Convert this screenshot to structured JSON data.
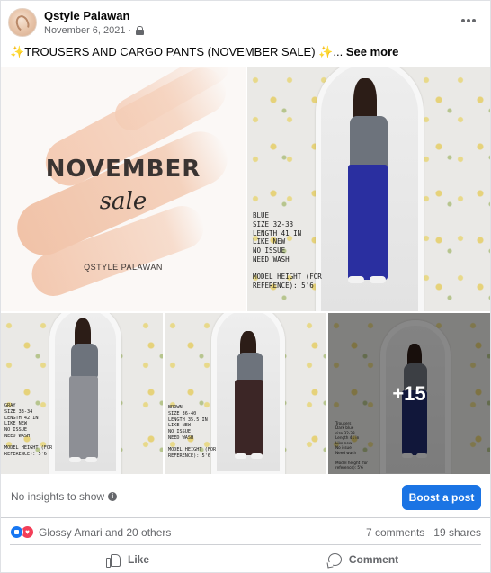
{
  "post": {
    "page_name": "Qstyle Palawan",
    "date": "November 6, 2021",
    "separator": "·",
    "privacy_icon": "lock-icon",
    "more_icon": "more-horizontal-icon"
  },
  "caption": {
    "sparkle_left": "✨",
    "text": "TROUSERS AND CARGO PANTS (NOVEMBER SALE) ",
    "sparkle_right": "✨",
    "ellipsis": "...",
    "see_more": "See more"
  },
  "media": {
    "cover": {
      "title": "NOVEMBER",
      "subtitle": "sale",
      "brand": "QSTYLE PALAWAN"
    },
    "items": [
      {
        "pants_color": "#2a2fa0",
        "label": "BLUE\nSIZE 32-33\nLENGTH 41 IN\nLIKE NEW\nNO ISSUE\nNEED WASH\n\nMODEL HEIGHT (FOR\nREFERENCE): 5'6"
      },
      {
        "pants_color": "#8d8f95",
        "label": "GRAY\nSIZE 33-34\nLENGTH 42 IN\nLIKE NEW\nNO ISSUE\nNEED WASH\n\nMODEL HEIGHT (FOR\nREFERENCE): 5'6"
      },
      {
        "pants_color": "#3c2626",
        "label": "BROWN\nSIZE 36-40\nLENGTH 35.5 IN\nLIKE NEW\nNO ISSUE\nNEED WASH\n\nMODEL HEIGHT (FOR\nREFERENCE): 5'6"
      },
      {
        "pants_color": "#1f2b6b",
        "label": "Trousers\nDark blue\nsize 32-33\nLength 41 in\nLike new\nNo issue\nNeed wash\n\nModel height (for\nreference): 5'6"
      }
    ],
    "more_count": "+15"
  },
  "insights": {
    "text": "No insights to show",
    "info_icon": "info-icon",
    "boost_label": "Boost a post"
  },
  "reactions": {
    "icons": [
      "like-reaction-icon",
      "love-reaction-icon"
    ],
    "reactors": "Glossy Amari and 20 others",
    "comments": "7 comments",
    "shares": "19 shares"
  },
  "actions": {
    "like": "Like",
    "comment": "Comment"
  },
  "colors": {
    "accent": "#1b74e4",
    "like_blue": "#1877f2",
    "love_red": "#f33e58",
    "secondary_text": "#65676b"
  }
}
